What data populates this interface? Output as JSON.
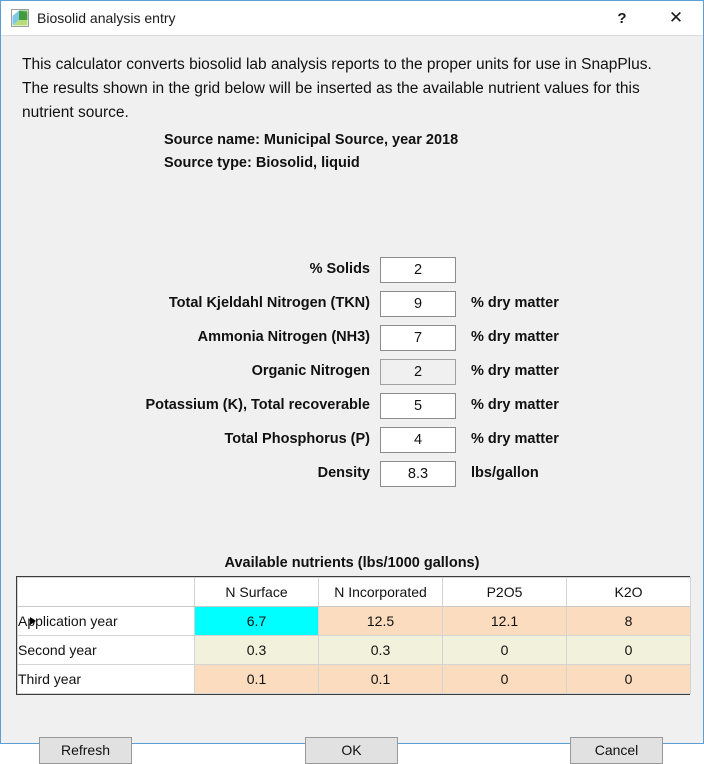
{
  "window": {
    "title": "Biosolid analysis entry",
    "icon": "app-logo-icon",
    "help_label": "?",
    "close_label": "✕",
    "border_color": "#5aa0d8"
  },
  "intro": {
    "text": "This calculator converts biosolid lab analysis reports to the proper units for use in SnapPlus.  The results shown in the grid below will be inserted as the available nutrient values for this nutrient source."
  },
  "source": {
    "name_line": "Source name: Municipal Source, year 2018",
    "type_line": "Source type: Biosolid, liquid"
  },
  "form": {
    "fields": [
      {
        "label": "% Solids",
        "value": "2",
        "unit": "",
        "disabled": false
      },
      {
        "label": "Total Kjeldahl Nitrogen (TKN)",
        "value": "9",
        "unit": "% dry matter",
        "disabled": false
      },
      {
        "label": "Ammonia Nitrogen (NH3)",
        "value": "7",
        "unit": "% dry matter",
        "disabled": false
      },
      {
        "label": "Organic Nitrogen",
        "value": "2",
        "unit": "% dry matter",
        "disabled": true
      },
      {
        "label": "Potassium (K), Total recoverable",
        "value": "5",
        "unit": "% dry matter",
        "disabled": false
      },
      {
        "label": "Total Phosphorus (P)",
        "value": "4",
        "unit": "% dry matter",
        "disabled": false
      },
      {
        "label": "Density",
        "value": "8.3",
        "unit": "lbs/gallon",
        "disabled": false
      }
    ]
  },
  "grid": {
    "title": "Available nutrients (lbs/1000 gallons)",
    "columns": [
      "",
      "N Surface",
      "N Incorporated",
      "P2O5",
      "K2O"
    ],
    "rows": [
      {
        "label": "Application year",
        "selected": true,
        "values": [
          "6.7",
          "12.5",
          "12.1",
          "8"
        ],
        "colors": [
          "cyan",
          "peach",
          "peach",
          "peach"
        ]
      },
      {
        "label": "Second year",
        "selected": false,
        "values": [
          "0.3",
          "0.3",
          "0",
          "0"
        ],
        "colors": [
          "cream",
          "cream",
          "cream",
          "cream"
        ]
      },
      {
        "label": "Third year",
        "selected": false,
        "values": [
          "0.1",
          "0.1",
          "0",
          "0"
        ],
        "colors": [
          "peach",
          "peach",
          "peach",
          "peach"
        ]
      }
    ],
    "cell_colors": {
      "cyan": "#00ffff",
      "peach": "#fcdcbe",
      "cream": "#f2f2dc"
    }
  },
  "buttons": {
    "refresh": "Refresh",
    "ok": "OK",
    "cancel": "Cancel"
  }
}
